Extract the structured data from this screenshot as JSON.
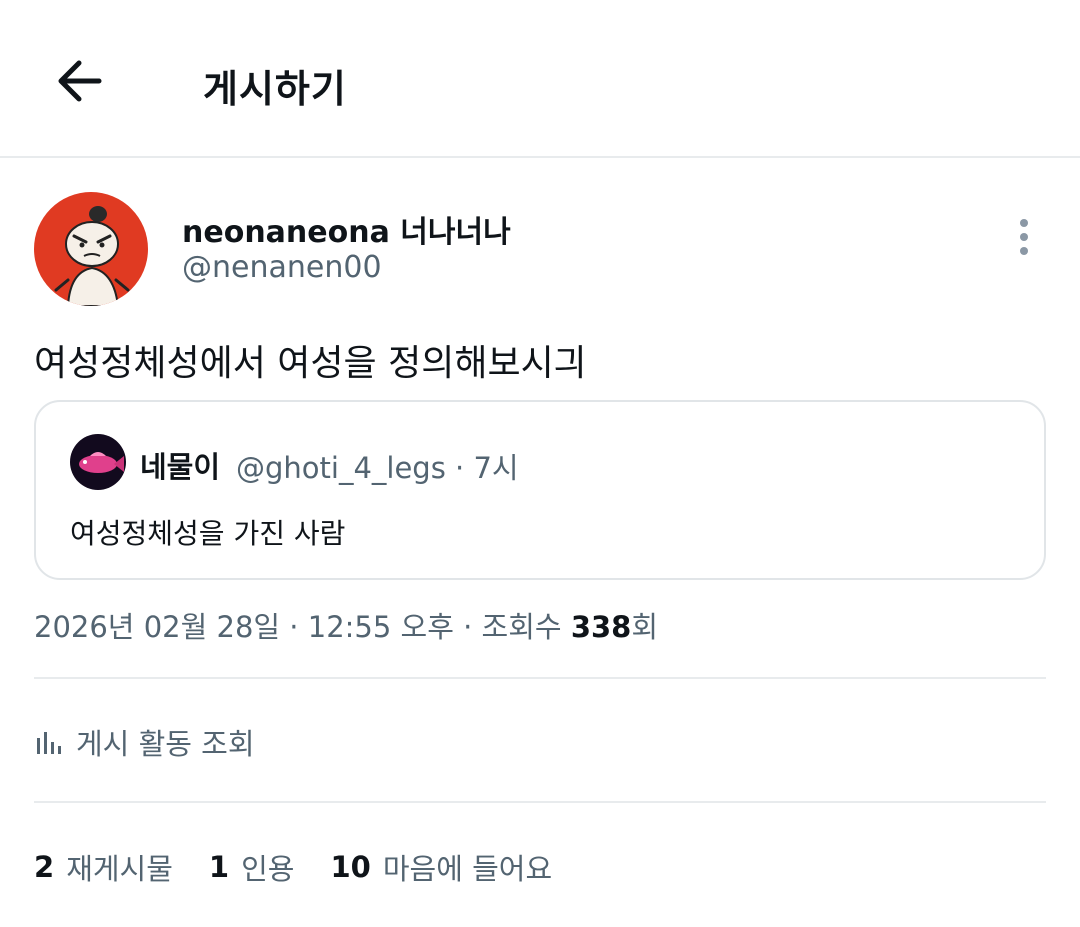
{
  "header": {
    "title": "게시하기",
    "back_icon": "arrow-left-icon"
  },
  "post": {
    "author": {
      "display_name": "neonaneona 너나너나",
      "handle": "@nenanen00"
    },
    "text": "여성정체성에서 여성을 정의해보시긔",
    "quote": {
      "display_name": "네물이",
      "handle": "@ghoti_4_legs · 7시",
      "text": "여성정체성을 가진 사람"
    },
    "meta": {
      "datetime": "2026년 02월 28일 · 12:55 오후 · 조회수 ",
      "views": "338",
      "views_suffix": "회"
    },
    "activity_label": "게시 활동 조회",
    "stats": [
      {
        "count": "2",
        "label": "재게시물"
      },
      {
        "count": "1",
        "label": "인용"
      },
      {
        "count": "10",
        "label": "마음에 들어요"
      }
    ]
  },
  "colors": {
    "text_primary": "#0f1419",
    "text_secondary": "#536471",
    "divider": "#e8ebed",
    "avatar_bg": "#e03a22"
  }
}
